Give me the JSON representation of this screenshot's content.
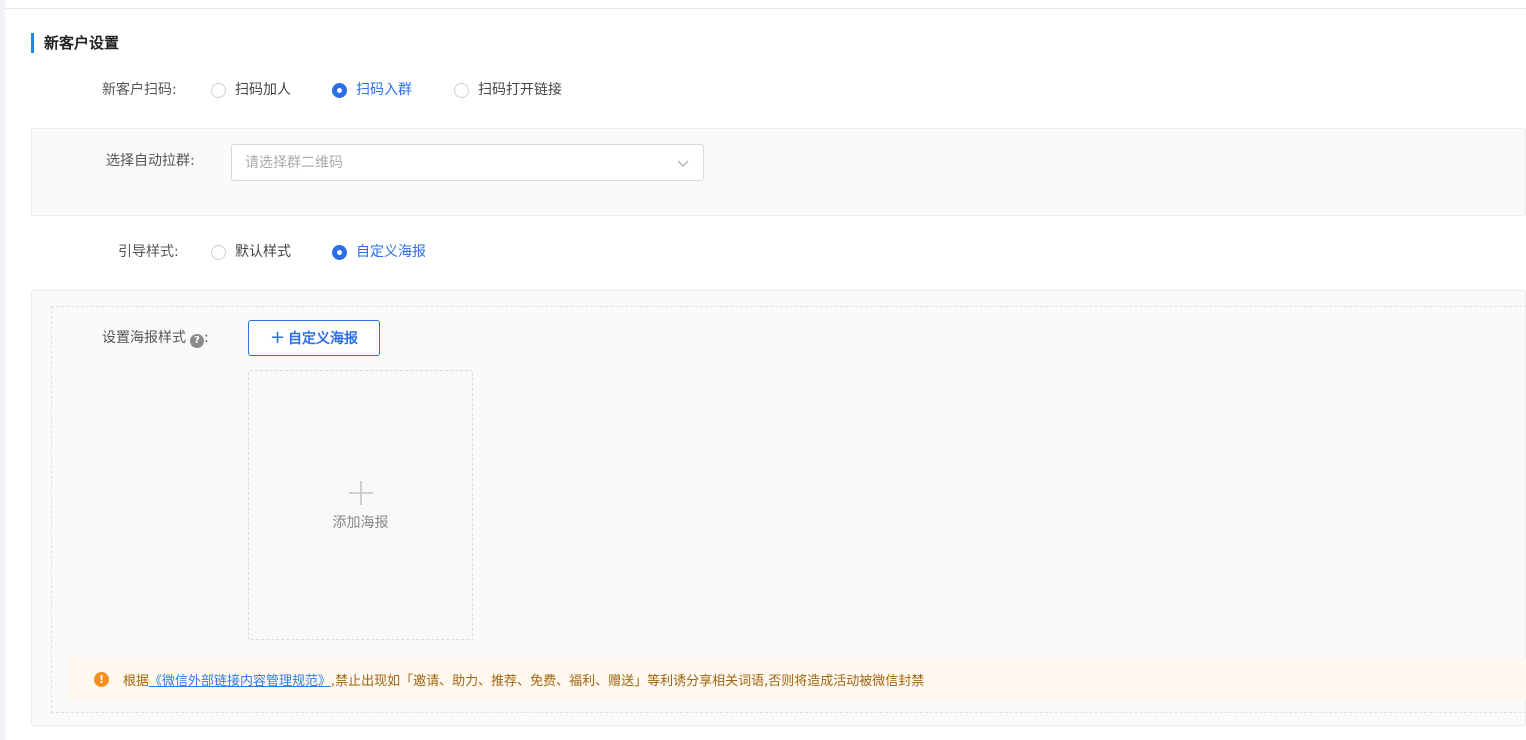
{
  "section": {
    "title": "新客户设置"
  },
  "scan": {
    "label": "新客户扫码:",
    "options": [
      {
        "label": "扫码加人",
        "checked": false
      },
      {
        "label": "扫码入群",
        "checked": true
      },
      {
        "label": "扫码打开链接",
        "checked": false
      }
    ]
  },
  "auto_group": {
    "label": "选择自动拉群:",
    "placeholder": "请选择群二维码"
  },
  "guide": {
    "label": "引导样式:",
    "options": [
      {
        "label": "默认样式",
        "checked": false
      },
      {
        "label": "自定义海报",
        "checked": true
      }
    ]
  },
  "poster": {
    "label": "设置海报样式",
    "label_suffix": ":",
    "help": "?",
    "custom_button": "自定义海报",
    "add_text": "添加海报"
  },
  "notice": {
    "prefix": "根据",
    "link": "《微信外部链接内容管理规范》",
    "suffix": ",禁止出现如「邀请、助力、推荐、免费、福利、赠送」等利诱分享相关词语,否则将造成活动被微信封禁",
    "icon": "!"
  },
  "colors": {
    "accent": "#2b6fe6",
    "title_bar": "#1e88e5",
    "warning": "#f5901e"
  }
}
